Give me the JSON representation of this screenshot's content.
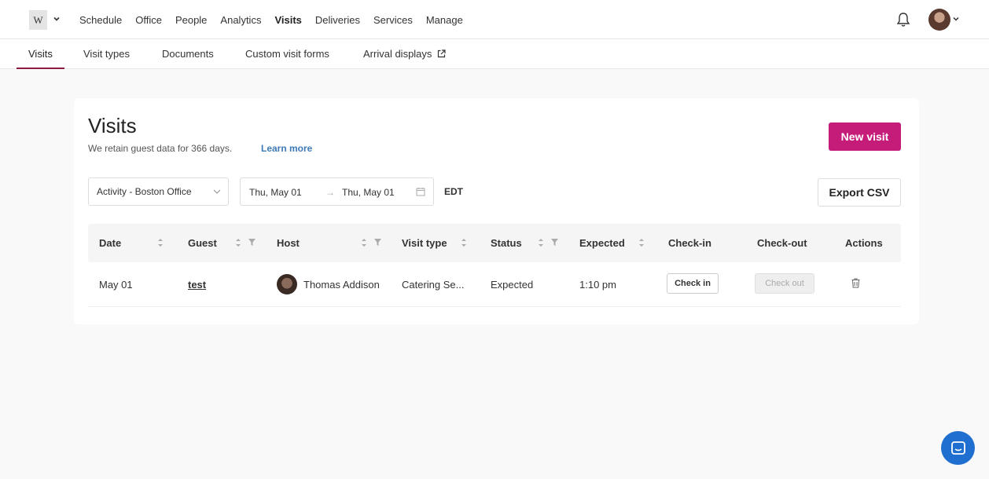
{
  "topnav": {
    "logo_text": "W",
    "items": [
      {
        "label": "Schedule"
      },
      {
        "label": "Office"
      },
      {
        "label": "People"
      },
      {
        "label": "Analytics"
      },
      {
        "label": "Visits"
      },
      {
        "label": "Deliveries"
      },
      {
        "label": "Services"
      },
      {
        "label": "Manage"
      }
    ],
    "active_item": "Visits",
    "icons": [
      "chevron-down-icon",
      "bell-icon",
      "avatar",
      "chevron-down-icon"
    ]
  },
  "subnav": {
    "tabs": [
      {
        "label": "Visits"
      },
      {
        "label": "Visit types"
      },
      {
        "label": "Documents"
      },
      {
        "label": "Custom visit forms"
      },
      {
        "label": "Arrival displays"
      }
    ],
    "active_tab": "Visits"
  },
  "main": {
    "title": "Visits",
    "retention_text": "We retain guest data for 366 days.",
    "learn_more": "Learn more",
    "new_visit_label": "New visit",
    "filter_label": "Activity - Boston Office",
    "date_start": "Thu, May 01",
    "date_end": "Thu, May 01",
    "timezone": "EDT",
    "export_label": "Export CSV"
  },
  "table": {
    "columns": {
      "date": "Date",
      "guest": "Guest",
      "host": "Host",
      "visit_type": "Visit type",
      "status": "Status",
      "expected": "Expected",
      "checkin": "Check-in",
      "checkout": "Check-out",
      "actions": "Actions"
    },
    "rows": [
      {
        "date": "May 01",
        "guest": "test",
        "host": "Thomas Addison",
        "visit_type": "Catering Se...",
        "status": "Expected",
        "expected": "1:10 pm",
        "checkin_label": "Check in",
        "checkout_label": "Check out"
      }
    ]
  },
  "colors": {
    "brand_accent": "#c51c79",
    "active_underline": "#8a1c3f",
    "link": "#3d7ab8",
    "chat": "#1f6fd1"
  }
}
